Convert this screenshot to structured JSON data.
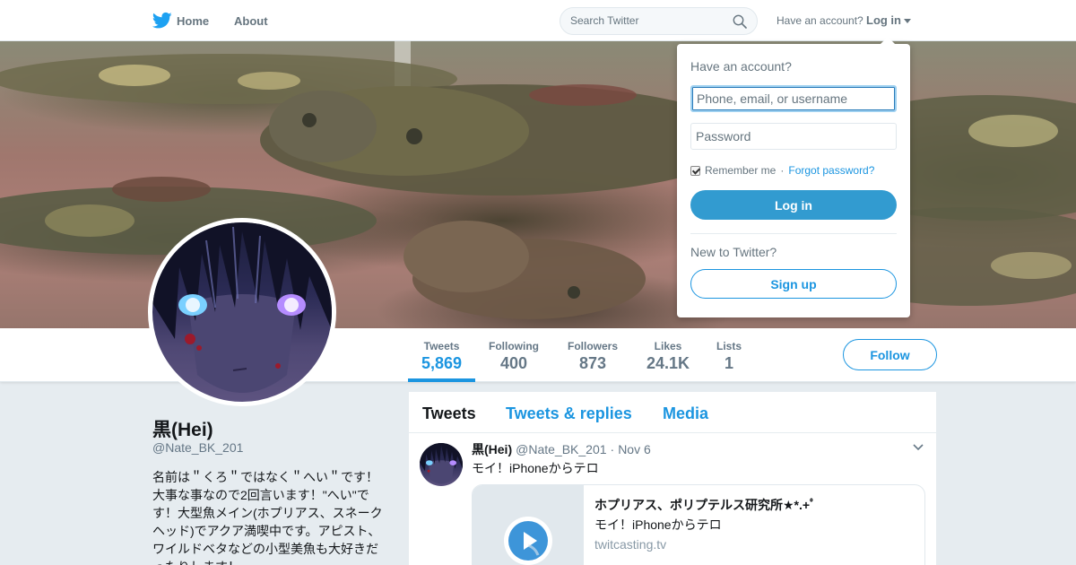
{
  "nav": {
    "home_label": "Home",
    "about_label": "About",
    "search_placeholder": "Search Twitter",
    "have_account": "Have an account?",
    "login_label": "Log in"
  },
  "profile": {
    "name": "黒(Hei)",
    "handle": "@Nate_BK_201",
    "bio": "名前は＂くろ＂ではなく＂へい＂です！大事な事なので2回言います！\"へい\"です！大型魚メイン(ホプリアス、スネークヘッド)でアクア満喫中です。アピスト、ワイルドベタなどの小型美魚も大好きだったりします！"
  },
  "stats": [
    {
      "label": "Tweets",
      "value": "5,869",
      "active": true
    },
    {
      "label": "Following",
      "value": "400"
    },
    {
      "label": "Followers",
      "value": "873"
    },
    {
      "label": "Likes",
      "value": "24.1K"
    },
    {
      "label": "Lists",
      "value": "1"
    }
  ],
  "follow_label": "Follow",
  "timeline": {
    "tabs": [
      {
        "label": "Tweets",
        "active": true
      },
      {
        "label": "Tweets & replies"
      },
      {
        "label": "Media"
      }
    ],
    "tweet": {
      "name": "黒(Hei)",
      "handle": "@Nate_BK_201",
      "separator": "·",
      "date": "Nov 6",
      "text": "モイ！iPhoneからテロ",
      "card": {
        "title": "ホプリアス、ポリプテルス研究所★*.+ﾟ",
        "description": "モイ！iPhoneからテロ",
        "domain": "twitcasting.tv"
      }
    }
  },
  "login_dropdown": {
    "title": "Have an account?",
    "username_placeholder": "Phone, email, or username",
    "password_placeholder": "Password",
    "remember_label": "Remember me",
    "separator": "·",
    "forgot_label": "Forgot password?",
    "login_button": "Log in",
    "new_to": "New to Twitter?",
    "signup_button": "Sign up"
  },
  "colors": {
    "accent": "#1b95e0",
    "login_button": "#329bd0"
  }
}
